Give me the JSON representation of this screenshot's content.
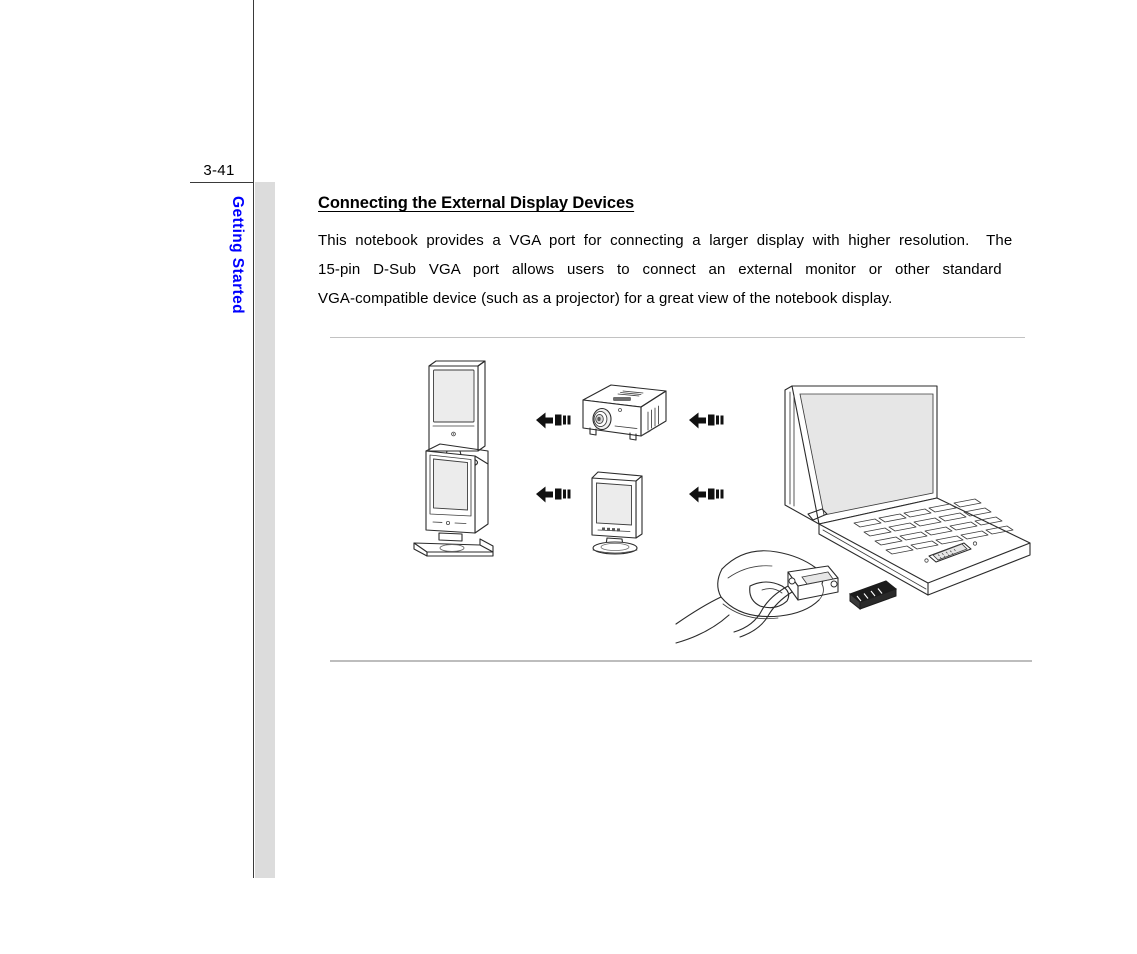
{
  "page": {
    "number": "3-41",
    "chapter_tab": "Getting Started",
    "chapter_tab_color": "#0000FF",
    "strip_color": "#DCDCDC",
    "rule_color": "#3A3A3A"
  },
  "content": {
    "heading": "Connecting the External Display Devices",
    "paragraph_lines": [
      "This  notebook  provides  a  VGA  port  for  connecting  a  larger  display  with  higher  resolution.    The",
      "15-pin   D-Sub   VGA   port   allows   users   to   connect   an   external   monitor   or   other   standard",
      "VGA-compatible device (such as a projector) for a great view of the notebook display."
    ],
    "paragraph_text": "This notebook provides a VGA port for connecting a larger display with higher resolution.  The 15-pin D-Sub VGA port allows users to connect an external monitor or other standard VGA-compatible device (such as a projector) for a great view of the notebook display."
  },
  "figure": {
    "rule_color_top": "#C2C2C2",
    "rule_color_bottom": "#BDBDBD",
    "devices": [
      {
        "name": "flat-panel-tv",
        "row": "top",
        "column": "left"
      },
      {
        "name": "crt-monitor",
        "row": "bottom",
        "column": "left"
      },
      {
        "name": "projector",
        "row": "top",
        "column": "middle"
      },
      {
        "name": "lcd-monitor",
        "row": "bottom",
        "column": "middle"
      },
      {
        "name": "notebook-vga-connection",
        "row": "both",
        "column": "right"
      }
    ],
    "arrows": [
      {
        "name": "arrow-left-top-inner",
        "direction": "left",
        "row": "top"
      },
      {
        "name": "arrow-left-bottom-inner",
        "direction": "left",
        "row": "bottom"
      },
      {
        "name": "arrow-left-top-outer",
        "direction": "left",
        "row": "top"
      },
      {
        "name": "arrow-left-bottom-outer",
        "direction": "left",
        "row": "bottom"
      }
    ],
    "notebook_detail": "hand plugging a 15-pin D-Sub VGA cable into the notebook VGA port"
  }
}
